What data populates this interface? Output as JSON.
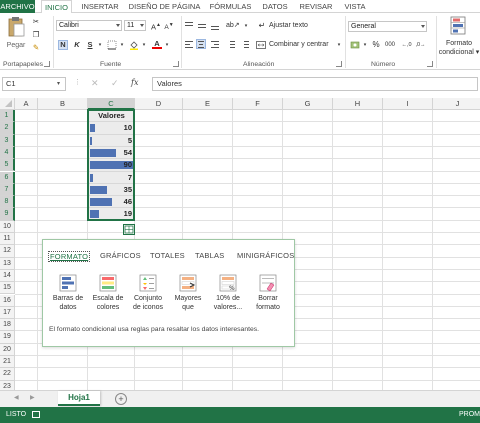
{
  "ribbon_tabs": [
    "ARCHIVO",
    "INICIO",
    "INSERTAR",
    "DISEÑO DE PÁGINA",
    "FÓRMULAS",
    "DATOS",
    "REVISAR",
    "VISTA"
  ],
  "ribbon": {
    "clipboard": {
      "paste_label": "Pegar",
      "group_label": "Portapapeles"
    },
    "font": {
      "font_name": "Calibri",
      "font_size": "11",
      "bold": "N",
      "italic": "K",
      "underline": "S",
      "group_label": "Fuente"
    },
    "alignment": {
      "wrap_text": "Ajustar texto",
      "merge_center": "Combinar y centrar",
      "group_label": "Alineación"
    },
    "number": {
      "format": "General",
      "percent": "%",
      "thousands": "000",
      "group_label": "Número"
    },
    "styles": {
      "conditional_line1": "Formato",
      "conditional_line2": "condicional"
    }
  },
  "formula_bar": {
    "name_box": "C1",
    "fx": "fx",
    "content": "Valores"
  },
  "grid": {
    "columns": [
      "A",
      "B",
      "C",
      "D",
      "E",
      "F",
      "G",
      "H",
      "I",
      "J"
    ],
    "selected_column": "C",
    "rows": [
      "1",
      "2",
      "3",
      "4",
      "5",
      "6",
      "7",
      "8",
      "9",
      "10",
      "11",
      "12",
      "13",
      "14",
      "15",
      "16",
      "17",
      "18",
      "19",
      "20",
      "21",
      "22",
      "23"
    ],
    "header_cell": "Valores",
    "values": [
      "10",
      "5",
      "54",
      "90",
      "7",
      "35",
      "46",
      "19"
    ],
    "bar_max": 90,
    "bar_color": "#4f72b3"
  },
  "quick_analysis": {
    "tabs": [
      "FORMATO",
      "GRÁFICOS",
      "TOTALES",
      "TABLAS",
      "MINIGRÁFICOS"
    ],
    "active_tab": "FORMATO",
    "items": [
      {
        "line1": "Barras de",
        "line2": "datos",
        "icon": "data-bars-icon"
      },
      {
        "line1": "Escala de",
        "line2": "colores",
        "icon": "color-scale-icon"
      },
      {
        "line1": "Conjunto",
        "line2": "de iconos",
        "icon": "icon-set-icon"
      },
      {
        "line1": "Mayores",
        "line2": "que",
        "icon": "greater-than-icon"
      },
      {
        "line1": "10% de",
        "line2": "valores...",
        "icon": "top-ten-percent-icon"
      },
      {
        "line1": "Borrar",
        "line2": "formato",
        "icon": "clear-format-icon"
      }
    ],
    "description": "El formato condicional usa reglas para resaltar los datos interesantes."
  },
  "sheets": {
    "active": "Hoja1",
    "add": "+"
  },
  "status": {
    "left": "LISTO",
    "right": "PROM"
  },
  "colors": {
    "accent": "#217346",
    "bar": "#4f72b3"
  }
}
